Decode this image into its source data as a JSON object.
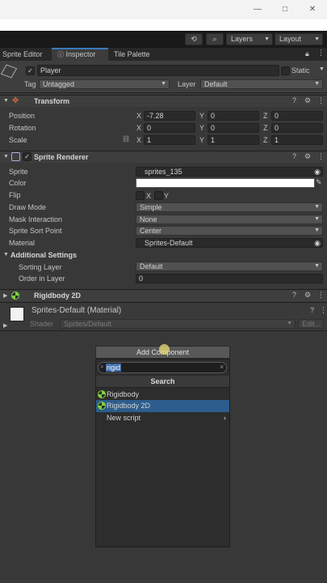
{
  "window": {
    "minimize_glyph": "—",
    "maximize_glyph": "□",
    "close_glyph": "✕"
  },
  "toolbar": {
    "layers_label": "Layers",
    "layout_label": "Layout"
  },
  "tabs": [
    {
      "label": "Sprite Editor"
    },
    {
      "label": "Inspector"
    },
    {
      "label": "Tile Palette"
    }
  ],
  "inspector": {
    "name": "Player",
    "static_label": "Static",
    "tag_label": "Tag",
    "tag_value": "Untagged",
    "layer_label": "Layer",
    "layer_value": "Default"
  },
  "transform": {
    "title": "Transform",
    "position_label": "Position",
    "rotation_label": "Rotation",
    "scale_label": "Scale",
    "position": {
      "x": "-7.28",
      "y": "0",
      "z": "0"
    },
    "rotation": {
      "x": "0",
      "y": "0",
      "z": "0"
    },
    "scale": {
      "x": "1",
      "y": "1",
      "z": "1"
    },
    "axis_x": "X",
    "axis_y": "Y",
    "axis_z": "Z"
  },
  "sprite_renderer": {
    "title": "Sprite Renderer",
    "sprite_label": "Sprite",
    "sprite_value": "sprites_135",
    "color_label": "Color",
    "flip_label": "Flip",
    "flip_x": "X",
    "flip_y": "Y",
    "draw_mode_label": "Draw Mode",
    "draw_mode_value": "Simple",
    "mask_label": "Mask Interaction",
    "mask_value": "None",
    "sort_point_label": "Sprite Sort Point",
    "sort_point_value": "Center",
    "material_label": "Material",
    "material_value": "Sprites-Default",
    "additional_label": "Additional Settings",
    "sorting_layer_label": "Sorting Layer",
    "sorting_layer_value": "Default",
    "order_label": "Order in Layer",
    "order_value": "0"
  },
  "rigidbody": {
    "title": "Rigidbody 2D"
  },
  "material": {
    "title": "Sprites-Default (Material)",
    "shader_label": "Shader",
    "shader_value": "Sprites/Default",
    "edit_label": "Edit..."
  },
  "add_component": {
    "button_label": "Add Component",
    "search_value": "rigid",
    "clear_glyph": "×",
    "header": "Search",
    "items": [
      {
        "label": "Rigidbody"
      },
      {
        "label": "Rigidbody 2D"
      },
      {
        "label": "New script"
      }
    ]
  },
  "colors": {
    "accent": "#3a79bb",
    "selection": "#2c5d8c",
    "rigidbody_icon": "#7ed23f",
    "panel_bg": "#383838"
  }
}
